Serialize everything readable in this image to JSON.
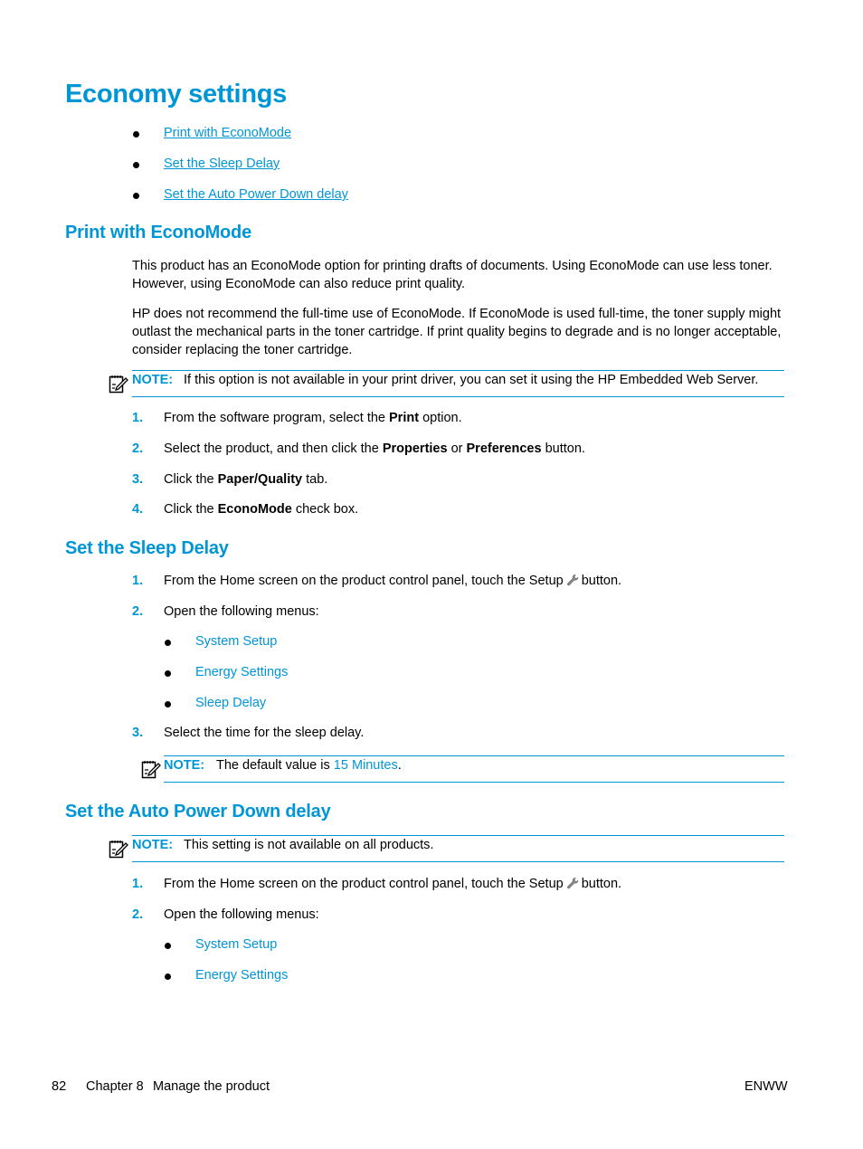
{
  "title": "Economy settings",
  "toc": [
    {
      "label": "Print with EconoMode"
    },
    {
      "label": "Set the Sleep Delay"
    },
    {
      "label": "Set the Auto Power Down delay"
    }
  ],
  "sections": {
    "econo": {
      "heading": "Print with EconoMode",
      "para1": "This product has an EconoMode option for printing drafts of documents. Using EconoMode can use less toner. However, using EconoMode can also reduce print quality.",
      "para2": "HP does not recommend the full-time use of EconoMode. If EconoMode is used full-time, the toner supply might outlast the mechanical parts in the toner cartridge. If print quality begins to degrade and is no longer acceptable, consider replacing the toner cartridge.",
      "note_label": "NOTE:",
      "note_text": "If this option is not available in your print driver, you can set it using the HP Embedded Web Server.",
      "steps": [
        {
          "num": "1.",
          "pre": "From the software program, select the ",
          "bold": "Print",
          "post": " option."
        },
        {
          "num": "2.",
          "pre": "Select the product, and then click the ",
          "bold": "Properties",
          "mid": " or ",
          "bold2": "Preferences",
          "post": " button."
        },
        {
          "num": "3.",
          "pre": "Click the ",
          "bold": "Paper/Quality",
          "post": " tab."
        },
        {
          "num": "4.",
          "pre": "Click the ",
          "bold": "EconoMode",
          "post": " check box."
        }
      ]
    },
    "sleep": {
      "heading": "Set the Sleep Delay",
      "steps": [
        {
          "num": "1.",
          "pre": "From the Home screen on the product control panel, touch the Setup",
          "post": "button."
        },
        {
          "num": "2.",
          "text": "Open the following menus:"
        },
        {
          "num": "3.",
          "text": "Select the time for the sleep delay."
        }
      ],
      "menus": [
        "System Setup",
        "Energy Settings",
        "Sleep Delay"
      ],
      "note_label": "NOTE:",
      "note_pre": "The default value is ",
      "note_value": "15 Minutes",
      "note_post": "."
    },
    "apd": {
      "heading": "Set the Auto Power Down delay",
      "note_label": "NOTE:",
      "note_text": "This setting is not available on all products.",
      "steps": [
        {
          "num": "1.",
          "pre": "From the Home screen on the product control panel, touch the Setup",
          "post": "button."
        },
        {
          "num": "2.",
          "text": "Open the following menus:"
        }
      ],
      "menus": [
        "System Setup",
        "Energy Settings"
      ]
    }
  },
  "footer": {
    "page_number": "82",
    "chapter": "Chapter 8",
    "chapter_title": "Manage the product",
    "right": "ENWW"
  }
}
